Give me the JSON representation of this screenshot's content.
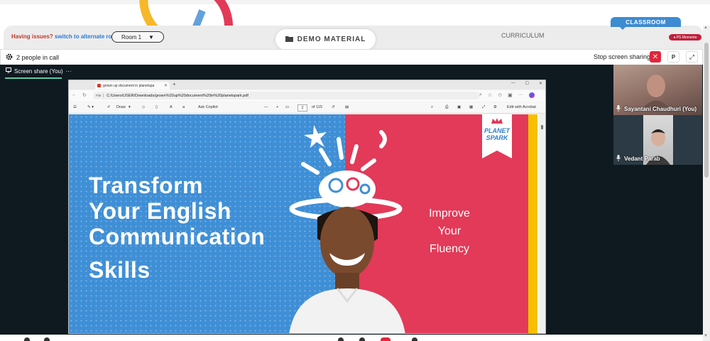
{
  "header": {
    "issue_prefix": "Having issues?",
    "issue_link": "switch to alternate room",
    "room_select": "Room 1",
    "demo_material": "DEMO MATERIAL",
    "curriculum": "CURRICULUM",
    "classroom": "CLASSROOM",
    "ps_moments": "PS Moments"
  },
  "callbar": {
    "people": "2 people in call",
    "stop_share": "Stop screen sharing",
    "p_label": "P"
  },
  "stage": {
    "share_tab": "Screen share (You)"
  },
  "browser": {
    "tab_title": "grown up document in planetspa",
    "file_chip": "File",
    "url": "C:/Users/USER/Downloads/grown%20up%20document%20in%20planetspark.pdf",
    "tools": {
      "draw": "Draw",
      "ask_copilot": "Ask Copilot",
      "page_current": "2",
      "page_total": "of 115",
      "edit_acrobat": "Edit with Acrobat"
    }
  },
  "pdf": {
    "headline": [
      "Transform",
      "Your English",
      "Communication",
      "Skills"
    ],
    "improve": [
      "Improve",
      "Your",
      "Fluency"
    ],
    "brand": [
      "PLANET",
      "SPARK"
    ],
    "colors": {
      "blue": "#3f8fd6",
      "red": "#e23a58",
      "yellow": "#f6c000"
    }
  },
  "participants": [
    {
      "name": "Sayantani Chaudhuri (You)"
    },
    {
      "name": "Vedant Parab"
    }
  ]
}
